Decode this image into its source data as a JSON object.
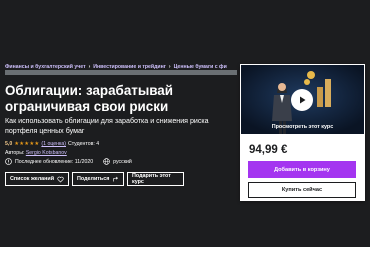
{
  "breadcrumb": {
    "items": [
      "Финансы и бухгалтерский учет",
      "Инвестирование и трейдинг",
      "Ценные бумаги с фи"
    ],
    "separator": "›"
  },
  "course": {
    "title": "Облигации: зарабатывай ограничивая свои риски",
    "subtitle": "Как использовать облигации для заработка и снижения риска портфеля ценных бумаг",
    "rating_value": "5,0",
    "stars": "★★★★★",
    "reviews": "(1 оценка)",
    "students": "Студентов: 4",
    "authors_label": "Авторы:",
    "author_name": "Sergio Kotsbanov",
    "last_updated": "Последнее обновление: 11/2020",
    "language": "русский"
  },
  "actions": {
    "wishlist_label": "Список желаний",
    "share_label": "Поделиться",
    "gift_label": "Подарить этот курс"
  },
  "purchase_card": {
    "preview_label": "Просмотреть этот курс",
    "price": "94,99 €",
    "add_to_cart_label": "Добавить в корзину",
    "buy_now_label": "Купить сейчас"
  },
  "colors": {
    "hero_bg": "#1c1d1f",
    "accent_purple": "#a435f0",
    "link_lavender": "#cec0fc",
    "rating_gold": "#f3ca8c",
    "star_orange": "#e59819"
  },
  "icons": {
    "heart": "heart-icon",
    "share": "share-icon",
    "alert": "alert-icon",
    "globe": "globe-icon",
    "play": "play-icon"
  }
}
